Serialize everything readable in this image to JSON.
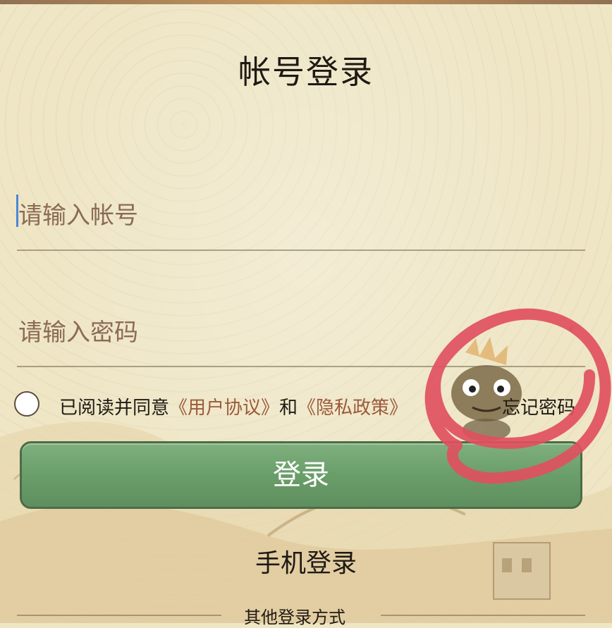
{
  "title": "帐号登录",
  "account": {
    "placeholder": "请输入帐号"
  },
  "password": {
    "placeholder": "请输入密码",
    "toggle_glyph": "‹"
  },
  "agreement": {
    "prefix": "已阅读并同意",
    "user_agreement": "《用户协议》",
    "and": "和",
    "privacy_policy": "《隐私政策》"
  },
  "forgot_password": "忘记密码",
  "login_button": "登录",
  "phone_login": "手机登录",
  "other_methods": "其他登录方式",
  "colors": {
    "background": "#efe6c6",
    "button": "#6a9e69",
    "link": "#9a5a3a",
    "scribble": "#e0505e"
  }
}
